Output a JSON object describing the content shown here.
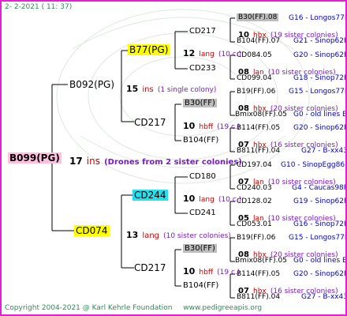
{
  "header": {
    "date": "2-  2-2021 ( 11: 37)"
  },
  "footer": {
    "copyright": "Copyright 2004-2021 @ Karl Kehrle Foundation",
    "url": "www.pedigreeapis.org"
  },
  "colors": {
    "frame": "#e81ed2",
    "line": "#000000",
    "green": "#2e8b57",
    "red": "#cc0000",
    "blue": "#0000cc",
    "purple": "#7b18c8",
    "yellow": "#ffff00",
    "cyan": "#22e0ee",
    "gray": "#bdbdbd",
    "pink": "#ffc0e0"
  },
  "gen1": {
    "name": "B099(PG)",
    "count": "17",
    "unit": "ins",
    "note": "(Drones from 2 sister colonies)"
  },
  "gen2": {
    "top": {
      "name": "B092(PG)",
      "count": "15",
      "unit": "ins",
      "note": "(1 single colony)"
    },
    "bottom": {
      "name": "CD074",
      "count": "13",
      "unit": "lang",
      "note": "(10 sister colonies)"
    }
  },
  "gen3": [
    {
      "name": "B77(PG)",
      "count": "12",
      "unit": "lang",
      "note": "(10 c.)"
    },
    {
      "name": "CD217",
      "count": "10",
      "unit": "hbff",
      "note": "(19 c.)"
    },
    {
      "name": "CD244",
      "count": "10",
      "unit": "lang",
      "note": "(10 c.)"
    },
    {
      "name": "CD217",
      "count": "10",
      "unit": "hbff",
      "note": "(19 c.)"
    }
  ],
  "gen4": [
    {
      "name": "CD217",
      "count": "10",
      "unit": "hbx",
      "note": "(19 sister colonies)"
    },
    {
      "name": "CD233",
      "count": "08",
      "unit": "lan",
      "note": "(10 sister colonies)"
    },
    {
      "name": "B30(FF)",
      "count": "08",
      "unit": "hbx",
      "note": "(20 sister colonies)"
    },
    {
      "name": "B104(FF)",
      "count": "07",
      "unit": "hbx",
      "note": "(16 sister colonies)"
    },
    {
      "name": "CD180",
      "count": "07",
      "unit": "lan",
      "note": "(10 sister colonies)"
    },
    {
      "name": "CD241",
      "count": "05",
      "unit": "lan",
      "note": "(10 sister colonies)"
    },
    {
      "name": "B30(FF)",
      "count": "08",
      "unit": "hbx",
      "note": "(20 sister colonies)"
    },
    {
      "name": "B104(FF)",
      "count": "07",
      "unit": "hbx",
      "note": "(16 sister colonies)"
    }
  ],
  "gen5": [
    {
      "name": "B30(FF).08",
      "info": "G16 - Longos77R"
    },
    {
      "name": "B104(FF).07",
      "info": "G21 - Sinop62R"
    },
    {
      "name": "CD084.05",
      "info": "G20 - Sinop62R"
    },
    {
      "name": "CD099.04",
      "info": "G18 - Sinop72R"
    },
    {
      "name": "B19(FF).06",
      "info": "G15 - Longos77R"
    },
    {
      "name": "Bmix08(FF).05",
      "info": "G0 - old lines B"
    },
    {
      "name": "B114(FF).05",
      "info": "G20 - Sinop62R"
    },
    {
      "name": "B811(FF).04",
      "info": "G27 - B-xx43"
    },
    {
      "name": "CD197.04",
      "info": "G10 - SinopEgg86R"
    },
    {
      "name": "CD240.03",
      "info": "G4 - Caucas98R"
    },
    {
      "name": "CD128.02",
      "info": "G19 - Sinop62R"
    },
    {
      "name": "CD053.01",
      "info": "G16 - Sinop72R"
    },
    {
      "name": "B19(FF).06",
      "info": "G15 - Longos77R"
    },
    {
      "name": "Bmix08(FF).05",
      "info": "G0 - old lines B"
    },
    {
      "name": "B114(FF).05",
      "info": "G20 - Sinop62R"
    },
    {
      "name": "B811(FF).04",
      "info": "G27 - B-xx43"
    }
  ]
}
